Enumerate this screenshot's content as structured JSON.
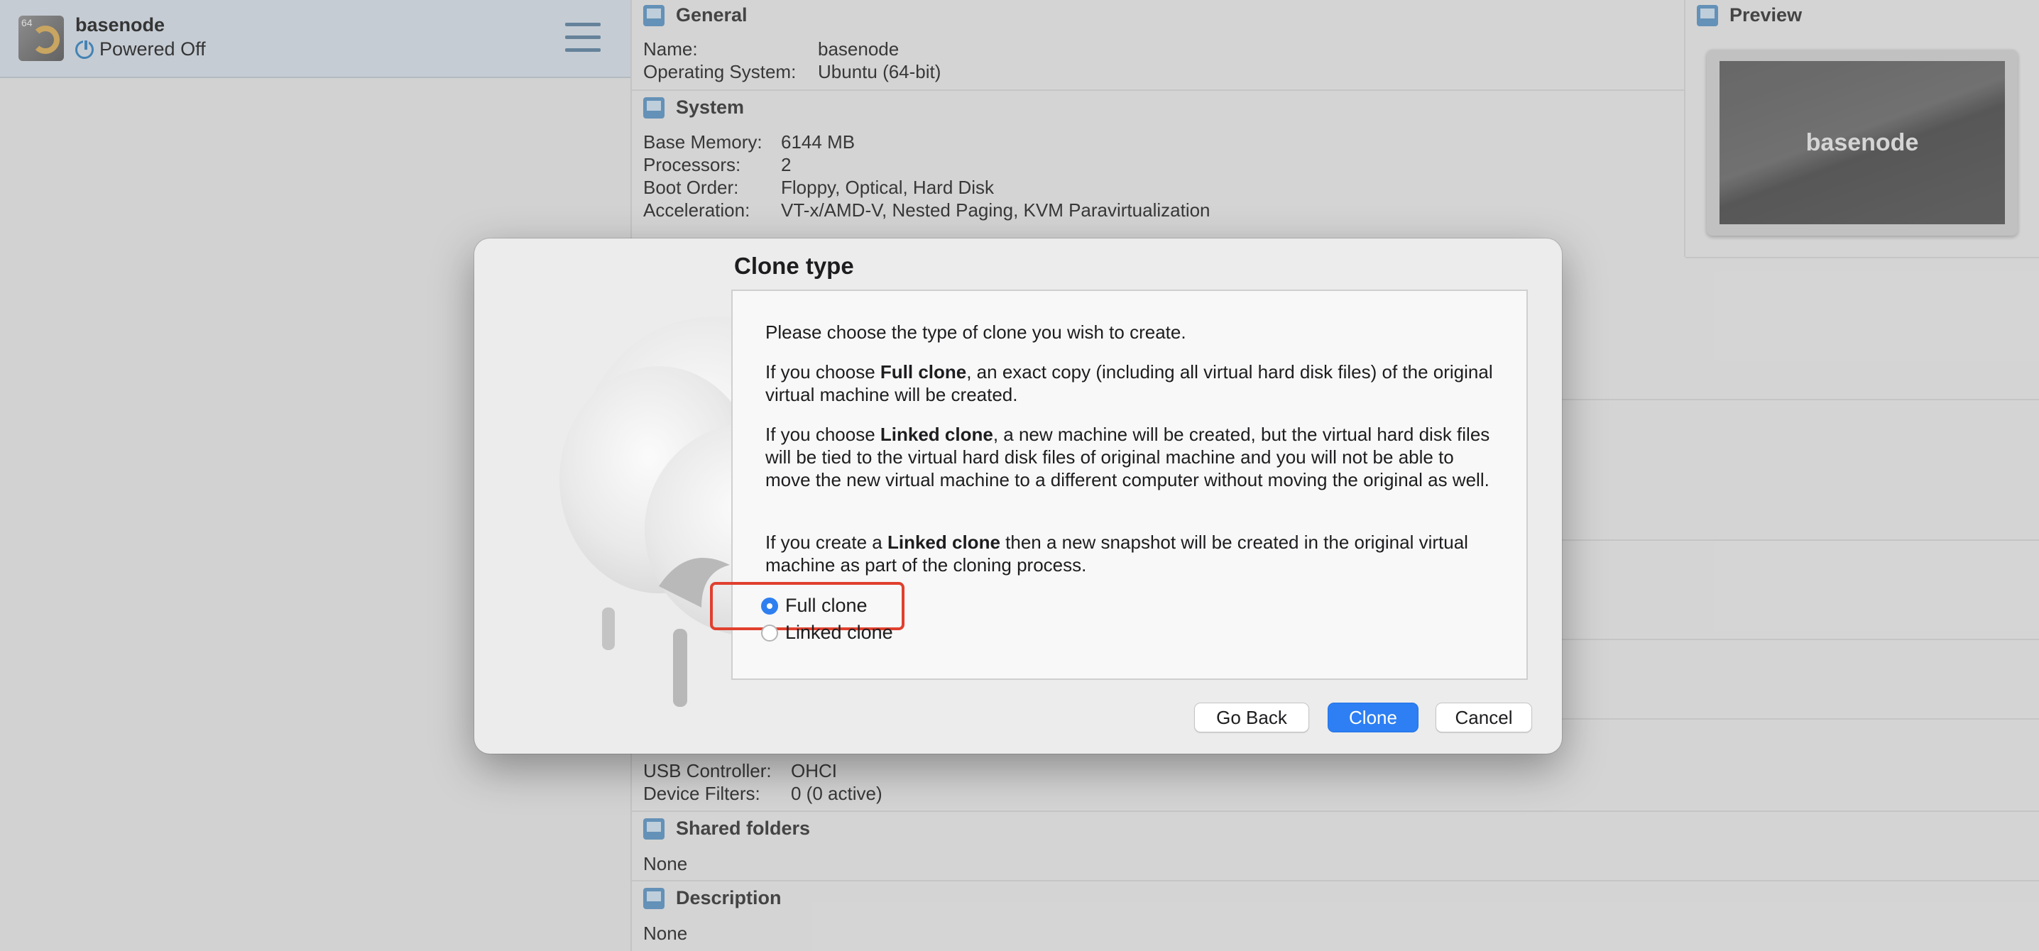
{
  "vm_list": {
    "items": [
      {
        "os_badge": "64",
        "name": "basenode",
        "state": "Powered Off"
      }
    ]
  },
  "details": {
    "general": {
      "title": "General",
      "rows": [
        {
          "label": "Name:",
          "value": "basenode"
        },
        {
          "label": "Operating System:",
          "value": "Ubuntu (64-bit)"
        }
      ]
    },
    "system": {
      "title": "System",
      "rows": [
        {
          "label": "Base Memory:",
          "value": "6144 MB"
        },
        {
          "label": "Processors:",
          "value": "2"
        },
        {
          "label": "Boot Order:",
          "value": "Floppy, Optical, Hard Disk"
        },
        {
          "label": "Acceleration:",
          "value": "VT-x/AMD-V, Nested Paging, KVM Paravirtualization"
        }
      ]
    },
    "usb": {
      "rows": [
        {
          "label": "USB Controller:",
          "value": "OHCI"
        },
        {
          "label": "Device Filters:",
          "value": "0 (0 active)"
        }
      ]
    },
    "shared_folders": {
      "title": "Shared folders",
      "value": "None"
    },
    "description": {
      "title": "Description",
      "value": "None"
    },
    "preview": {
      "title": "Preview",
      "screen_text": "basenode"
    }
  },
  "dialog": {
    "title": "Clone type",
    "intro": "Please choose the type of clone you wish to create.",
    "full_para": {
      "pre": "If you choose ",
      "bold": "Full clone",
      "post": ", an exact copy (including all virtual hard disk files) of the original virtual machine will be created."
    },
    "linked_para": {
      "pre": "If you choose ",
      "bold": "Linked clone",
      "post": ", a new machine will be created, but the virtual hard disk files will be tied to the virtual hard disk files of original machine and you will not be able to move the new virtual machine to a different computer without moving the original as well."
    },
    "snapshot_para": {
      "pre": "If you create a ",
      "bold": "Linked clone",
      "post": " then a new snapshot will be created in the original virtual machine as part of the cloning process."
    },
    "options": [
      {
        "label": "Full clone",
        "selected": true
      },
      {
        "label": "Linked clone",
        "selected": false
      }
    ],
    "buttons": {
      "back": "Go Back",
      "clone": "Clone",
      "cancel": "Cancel"
    }
  },
  "colors": {
    "accent": "#2d7ff3",
    "highlight": "#e0402e"
  }
}
